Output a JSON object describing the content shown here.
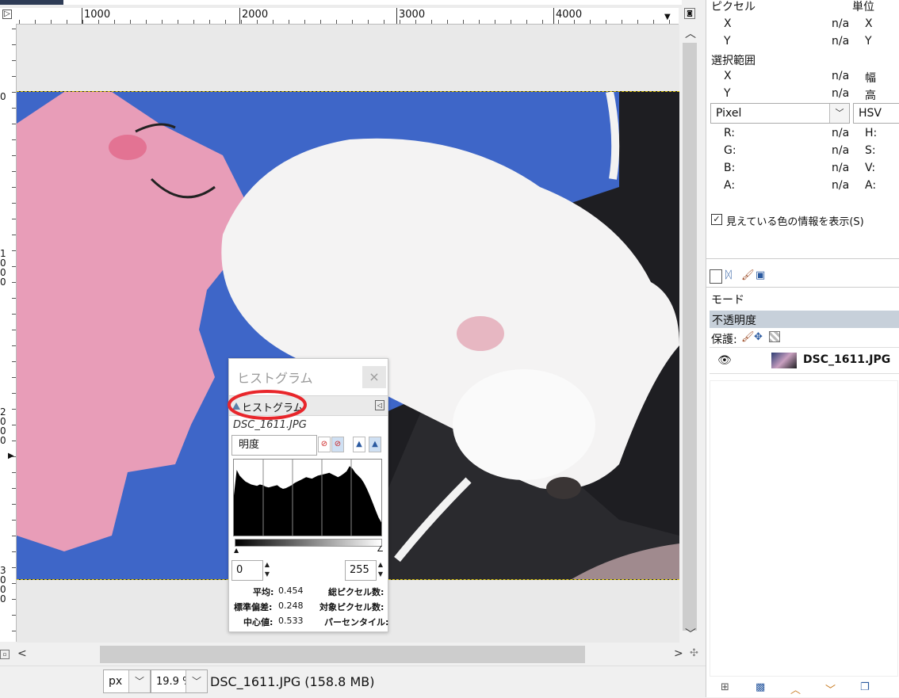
{
  "ruler_top": {
    "labels": [
      "1000",
      "2000",
      "3000",
      "4000"
    ]
  },
  "ruler_left": {
    "labels": [
      "0",
      "1\n0\n0\n0",
      "2\n0\n0\n0",
      "3\n0\n0\n0"
    ]
  },
  "statusbar": {
    "unit": "px",
    "zoom": "19.9 %",
    "file_info": "DSC_1611.JPG (158.8 MB)"
  },
  "pointer_panel": {
    "pixel_header": "ピクセル",
    "unit_header": "単位",
    "rows": [
      {
        "axis": "X",
        "value": "n/a",
        "unit_axis": "X"
      },
      {
        "axis": "Y",
        "value": "n/a",
        "unit_axis": "Y"
      }
    ],
    "selection_header": "選択範囲",
    "selection_rows": [
      {
        "axis": "X",
        "value": "n/a",
        "label": "幅"
      },
      {
        "axis": "Y",
        "value": "n/a",
        "label": "高"
      }
    ],
    "color_mode_left": "Pixel",
    "color_mode_right": "HSV",
    "color_rows": [
      {
        "ch": "R:",
        "value": "n/a",
        "ch2": "H:"
      },
      {
        "ch": "G:",
        "value": "n/a",
        "ch2": "S:"
      },
      {
        "ch": "B:",
        "value": "n/a",
        "ch2": "V:"
      },
      {
        "ch": "A:",
        "value": "n/a",
        "ch2": "A:"
      }
    ],
    "sample_merged_label": "見えている色の情報を表示(S)"
  },
  "layers_panel": {
    "mode_label": "モード",
    "opacity_label": "不透明度",
    "lock_label": "保護:",
    "layer_name": "DSC_1611.JPG"
  },
  "histogram_dialog": {
    "window_title": "ヒストグラム",
    "tab_label": "ヒストグラム",
    "file_name": "DSC_1611.JPG",
    "channel": "明度",
    "range_min": "0",
    "range_max": "255",
    "stats": {
      "mean_label": "平均:",
      "mean": "0.454",
      "stddev_label": "標準偏差:",
      "stddev": "0.248",
      "median_label": "中心値:",
      "median": "0.533",
      "pixels_label": "総ピクセル数:",
      "count_label": "対象ピクセル数:",
      "percentile_label": "パーセンタイル:"
    },
    "histogram_profile": [
      0.55,
      0.9,
      0.82,
      0.78,
      0.74,
      0.72,
      0.7,
      0.69,
      0.68,
      0.7,
      0.69,
      0.67,
      0.66,
      0.67,
      0.68,
      0.69,
      0.66,
      0.64,
      0.65,
      0.67,
      0.69,
      0.72,
      0.74,
      0.76,
      0.78,
      0.8,
      0.79,
      0.78,
      0.8,
      0.82,
      0.83,
      0.84,
      0.85,
      0.86,
      0.84,
      0.82,
      0.8,
      0.82,
      0.85,
      0.88,
      0.95,
      0.92,
      0.86,
      0.82,
      0.78,
      0.72,
      0.64,
      0.55,
      0.45,
      0.35,
      0.25,
      0.18
    ]
  },
  "colors": {
    "accent_red": "#e8262b",
    "sofa_blue": "#3e66c8",
    "highlight_row": "#c7d0da"
  }
}
